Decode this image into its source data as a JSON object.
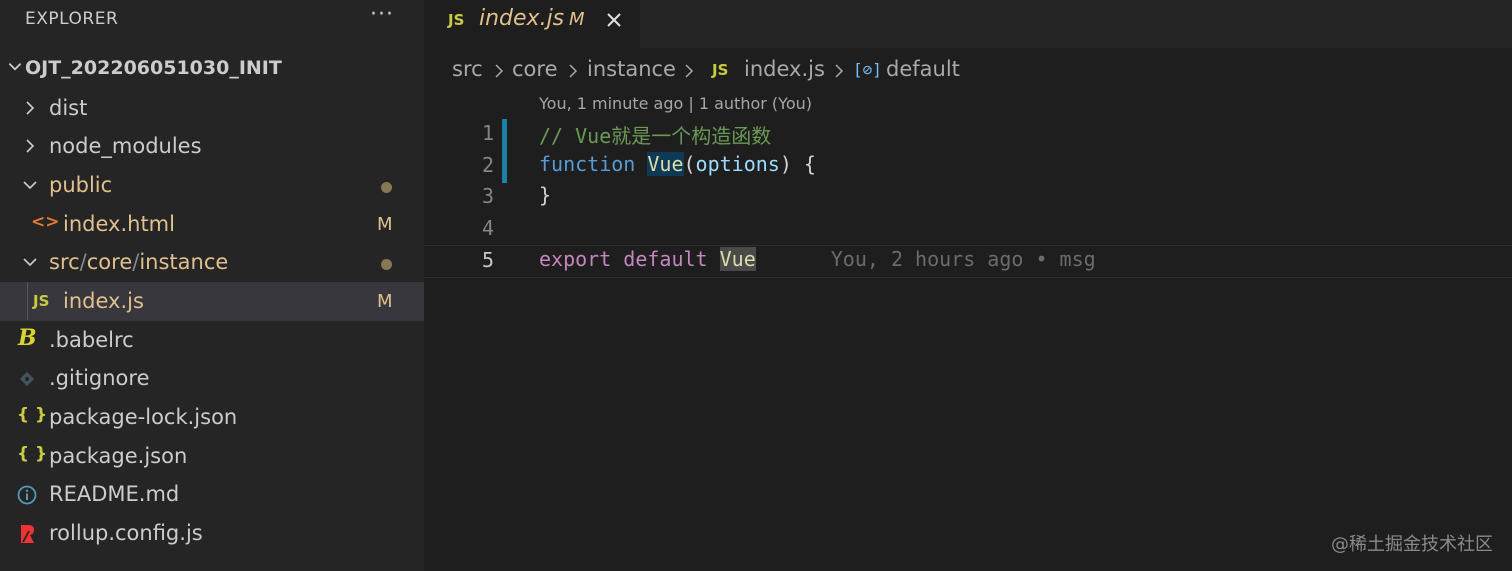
{
  "sidebar": {
    "title": "EXPLORER",
    "more_label": "···",
    "project": "OJT_202206051030_INIT",
    "items": [
      {
        "label": "dist"
      },
      {
        "label": "node_modules"
      },
      {
        "label": "public"
      },
      {
        "label": "index.html",
        "badge": "M"
      },
      {
        "label_parts": [
          "src",
          "/",
          "core",
          "/",
          "instance"
        ]
      },
      {
        "label": "index.js",
        "badge": "M"
      },
      {
        "label": ".babelrc"
      },
      {
        "label": ".gitignore"
      },
      {
        "label": "package-lock.json"
      },
      {
        "label": "package.json"
      },
      {
        "label": "README.md"
      },
      {
        "label": "rollup.config.js"
      }
    ],
    "icons": {
      "js": "JS",
      "html": "<>",
      "json": "{ }",
      "info": "i",
      "babel": "B"
    }
  },
  "tab": {
    "icon": "JS",
    "name": "index.js",
    "badge": "M"
  },
  "breadcrumb": {
    "parts": [
      "src",
      "core",
      "instance",
      "index.js",
      "default"
    ],
    "js_icon": "JS",
    "symbol_icon": "[⊘]"
  },
  "editor": {
    "blame_header": "You, 1 minute ago | 1 author (You)",
    "line_numbers": [
      "1",
      "2",
      "3",
      "4",
      "5"
    ],
    "line1": {
      "comment": "// Vue就是一个构造函数"
    },
    "line2": {
      "kw": "function",
      "name": "Vue",
      "open": "(",
      "param": "options",
      "close": ") {"
    },
    "line3": {
      "text": "}"
    },
    "line5": {
      "kw": "export default",
      "name": "Vue",
      "blame": "You, 2 hours ago • msg"
    }
  },
  "watermark": "@稀土掘金技术社区",
  "colors": {
    "modified": "#e2c08d",
    "js_icon": "#cbcb41",
    "git_bar": "#1b81a8"
  }
}
